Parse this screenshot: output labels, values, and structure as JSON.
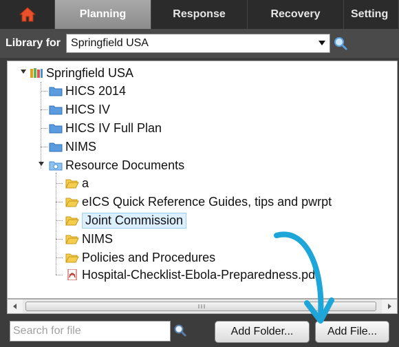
{
  "nav": {
    "tabs": [
      {
        "label": "Planning",
        "active": true
      },
      {
        "label": "Response",
        "active": false
      },
      {
        "label": "Recovery",
        "active": false
      },
      {
        "label": "Setting",
        "active": false
      }
    ]
  },
  "library": {
    "label": "Library for",
    "selected": "Springfield USA"
  },
  "tree": {
    "root": "Springfield USA",
    "items": [
      {
        "label": "HICS 2014",
        "type": "folder-blue"
      },
      {
        "label": "HICS IV",
        "type": "folder-blue"
      },
      {
        "label": "HICS IV Full Plan",
        "type": "folder-blue"
      },
      {
        "label": "NIMS",
        "type": "folder-blue"
      },
      {
        "label": "Resource Documents",
        "type": "resources"
      }
    ],
    "children": [
      {
        "label": "a",
        "type": "folder-yellow"
      },
      {
        "label": "eICS Quick Reference Guides, tips and pwrpt",
        "type": "folder-yellow"
      },
      {
        "label": "Joint Commission",
        "type": "folder-yellow",
        "selected": true
      },
      {
        "label": "NIMS",
        "type": "folder-yellow"
      },
      {
        "label": "Policies and Procedures",
        "type": "folder-yellow"
      },
      {
        "label": "Hospital-Checklist-Ebola-Preparedness.pdf",
        "type": "pdf"
      }
    ]
  },
  "search": {
    "placeholder": "Search for file"
  },
  "buttons": {
    "add_folder": "Add Folder...",
    "add_file": "Add File..."
  },
  "colors": {
    "nav_bg": "#2b2b2b",
    "active_tab": "#9a9a9a",
    "selection_bg": "#dcefff",
    "annotation_arrow": "#1fa6d8"
  }
}
